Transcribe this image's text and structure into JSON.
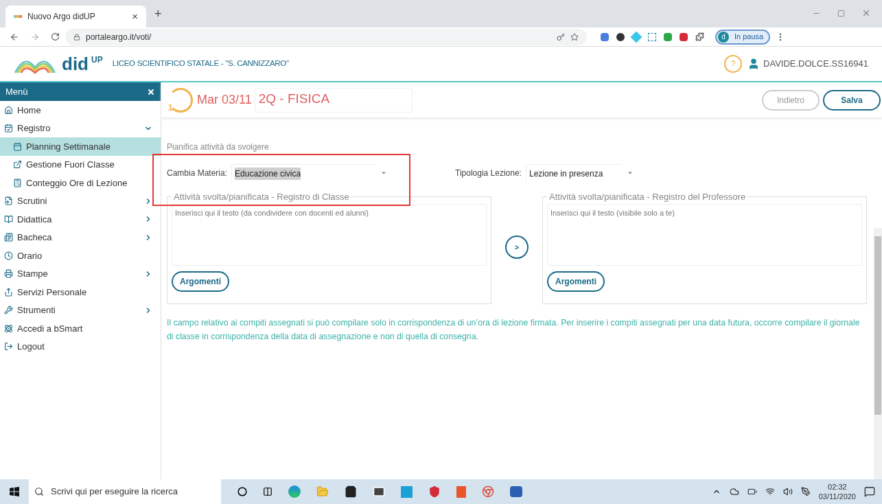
{
  "browser": {
    "tab_title": "Nuovo Argo didUP",
    "tab_close": "×",
    "new_tab": "+",
    "url": "portaleargo.it/voti/",
    "profile_initial": "d",
    "profile_label": "In pausa"
  },
  "app_header": {
    "logo_text": "did",
    "logo_sup": "UP",
    "school": "LICEO SCIENTIFICO STATALE - \"S. CANNIZZARO\"",
    "help": "?",
    "user": "DAVIDE.DOLCE.SS16941"
  },
  "sidebar": {
    "title": "Menù",
    "items": [
      {
        "label": "Home"
      },
      {
        "label": "Registro",
        "expanded": true,
        "children": [
          {
            "label": "Planning Settimanale",
            "selected": true
          },
          {
            "label": "Gestione Fuori Classe",
            "selected": false
          },
          {
            "label": "Conteggio Ore di Lezione",
            "selected": false
          }
        ]
      },
      {
        "label": "Scrutini",
        "expanded": false
      },
      {
        "label": "Didattica",
        "expanded": false
      },
      {
        "label": "Bacheca",
        "expanded": false
      },
      {
        "label": "Orario"
      },
      {
        "label": "Stampe",
        "expanded": false
      },
      {
        "label": "Servizi Personale"
      },
      {
        "label": "Strumenti",
        "expanded": false
      },
      {
        "label": "Accedi a bSmart"
      },
      {
        "label": "Logout"
      }
    ]
  },
  "lesson": {
    "hour": "1",
    "date": "Mar 03/11",
    "class_subject": "2Q - FISICA",
    "buttons": [
      {
        "label": "Indietro",
        "primary": false
      },
      {
        "label": "Salva",
        "primary": true
      }
    ]
  },
  "form": {
    "section_title": "Pianifica attività da svolgere",
    "fields": [
      {
        "label": "Cambia Materia:",
        "value": "Educazione civica",
        "highlighted": true
      },
      {
        "label": "Tipologia Lezione:",
        "value": "Lezione in presenza",
        "highlighted": false
      }
    ],
    "panels": [
      {
        "legend": "Attività svolta/pianificata - Registro di Classe",
        "placeholder": "Inserisci qui il testo (da condividere con docenti ed alunni)",
        "button": "Argomenti"
      },
      {
        "legend": "Attività svolta/pianificata - Registro del Professore",
        "placeholder": "Inserisci qui il testo (visibile solo a te)",
        "button": "Argomenti"
      }
    ],
    "copy_button": ">",
    "notice": "Il campo relativo ai compiti assegnati si può compilare solo in corrispondenza di un’ora di lezione firmata. Per inserire i compiti assegnati per una data futura, occorre compilare il giornale di classe in corrispondenza della data di assegnazione e non di quella di consegna."
  },
  "taskbar": {
    "search_placeholder": "Scrivi qui per eseguire la ricerca",
    "time": "02:32",
    "date": "03/11/2020"
  }
}
